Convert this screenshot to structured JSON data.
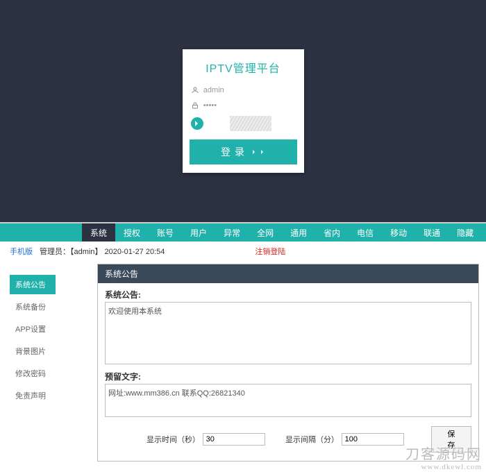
{
  "login": {
    "title": "IPTV管理平台",
    "username": "admin",
    "password": "·····",
    "captcha_placeholder": "",
    "button": "登录"
  },
  "topnav": {
    "items": [
      {
        "label": "系统",
        "active": true
      },
      {
        "label": "授权"
      },
      {
        "label": "账号"
      },
      {
        "label": "用户"
      },
      {
        "label": "异常"
      },
      {
        "label": "全网"
      },
      {
        "label": "通用"
      },
      {
        "label": "省内"
      },
      {
        "label": "电信"
      },
      {
        "label": "移动"
      },
      {
        "label": "联通"
      },
      {
        "label": "隐藏"
      }
    ]
  },
  "infobar": {
    "mobile": "手机版",
    "admin_label": "管理员：【admin】",
    "datetime": "2020-01-27 20:54",
    "logout": "注销登陆"
  },
  "sidebar": {
    "items": [
      {
        "label": "系统公告",
        "active": true
      },
      {
        "label": "系统备份"
      },
      {
        "label": "APP设置"
      },
      {
        "label": "背景图片"
      },
      {
        "label": "修改密码"
      },
      {
        "label": "免责声明"
      }
    ]
  },
  "panel": {
    "title": "系统公告",
    "notice_label": "系统公告:",
    "notice_value": "欢迎使用本系统",
    "reserve_label": "预留文字:",
    "reserve_value": "网址:www.mm386.cn 联系QQ:26821340",
    "duration_label": "显示时间（秒）",
    "duration_value": "30",
    "interval_label": "显示间隔（分）",
    "interval_value": "100",
    "save": "保 存"
  },
  "watermark": {
    "cn": "刀客源码网",
    "en": "www.dkewl.com"
  }
}
